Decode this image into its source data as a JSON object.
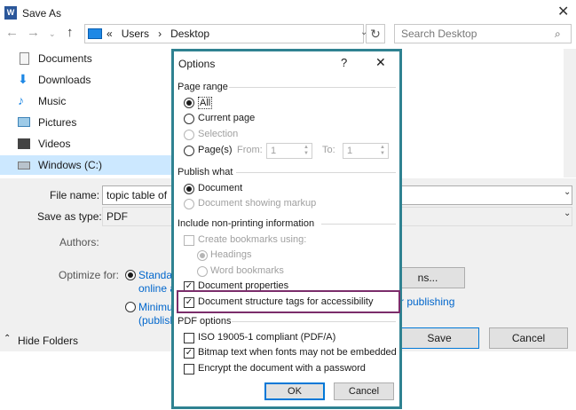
{
  "window": {
    "title": "Save As",
    "icon": "word-icon",
    "close": "✕"
  },
  "nav": {
    "breadcrumb_prefix": "«",
    "crumbs": [
      "Users",
      "Desktop"
    ],
    "separator": "›",
    "search_placeholder": "Search Desktop"
  },
  "sidebar": {
    "items": [
      {
        "label": "Documents",
        "icon": "documents-icon"
      },
      {
        "label": "Downloads",
        "icon": "downloads-icon"
      },
      {
        "label": "Music",
        "icon": "music-icon"
      },
      {
        "label": "Pictures",
        "icon": "pictures-icon"
      },
      {
        "label": "Videos",
        "icon": "videos-icon"
      },
      {
        "label": "Windows (C:)",
        "icon": "drive-icon"
      }
    ]
  },
  "form": {
    "file_name_label": "File name:",
    "file_name_value": "topic table of",
    "save_type_label": "Save as type:",
    "save_type_value": "PDF",
    "authors_label": "Authors:",
    "optimize_label": "Optimize for:",
    "optimize_standard_1": "Standard",
    "optimize_standard_2": "online a",
    "optimize_minimum_1": "Minimu",
    "optimize_minimum_2": "(publish",
    "options_button": "ns...",
    "open_after": "r publishing",
    "hide_folders": "Hide Folders",
    "save_button": "Save",
    "cancel_button": "Cancel"
  },
  "options": {
    "title": "Options",
    "help": "?",
    "close": "✕",
    "page_range": "Page range",
    "all": "All",
    "current_page": "Current page",
    "selection": "Selection",
    "pages": "Page(s)",
    "from": "From:",
    "from_value": "1",
    "to": "To:",
    "to_value": "1",
    "publish_what": "Publish what",
    "document": "Document",
    "document_markup": "Document showing markup",
    "non_printing": "Include non-printing information",
    "create_bookmarks": "Create bookmarks using:",
    "headings": "Headings",
    "word_bookmarks": "Word bookmarks",
    "document_properties": "Document properties",
    "structure_tags": "Document structure tags for accessibility",
    "pdf_options": "PDF options",
    "iso": "ISO 19005-1 compliant (PDF/A)",
    "bitmap": "Bitmap text when fonts may not be embedded",
    "encrypt": "Encrypt the document with a password",
    "ok": "OK",
    "cancel": "Cancel",
    "checkmark": "✓"
  },
  "colors": {
    "dialog_border": "#2f8291",
    "highlight": "#7b2d6b",
    "selection": "#cce8ff",
    "link": "#0066cc"
  }
}
